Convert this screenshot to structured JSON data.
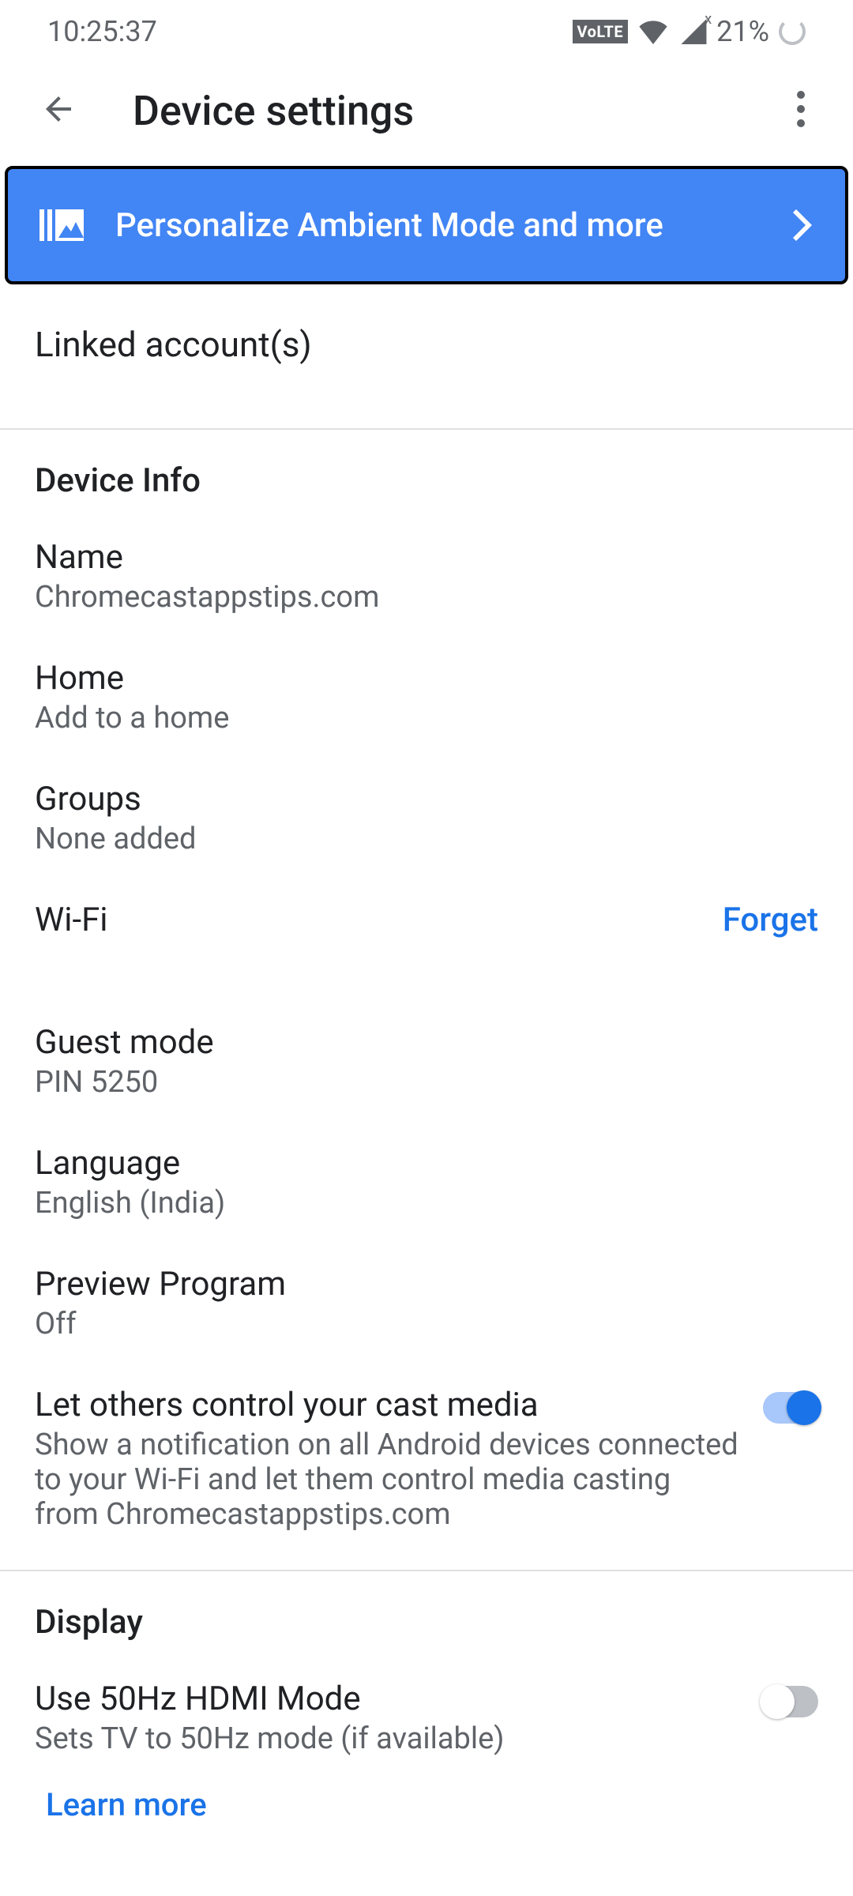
{
  "statusbar": {
    "time": "10:25:37",
    "volte": "VoLTE",
    "battery": "21%"
  },
  "appbar": {
    "title": "Device settings"
  },
  "banner": {
    "text": "Personalize Ambient Mode and more"
  },
  "linked_accounts": {
    "label": "Linked account(s)"
  },
  "sections": {
    "device_info_header": "Device Info",
    "name": {
      "title": "Name",
      "sub": "Chromecastappstips.com"
    },
    "home": {
      "title": "Home",
      "sub": "Add to a home"
    },
    "groups": {
      "title": "Groups",
      "sub": "None added"
    },
    "wifi": {
      "title": "Wi-Fi",
      "action": "Forget"
    },
    "guest_mode": {
      "title": "Guest mode",
      "sub": "PIN 5250"
    },
    "language": {
      "title": "Language",
      "sub": "English (India)"
    },
    "preview": {
      "title": "Preview Program",
      "sub": "Off"
    },
    "cast_control": {
      "title": "Let others control your cast media",
      "sub": "Show a notification on all Android devices connected to your Wi-Fi and let them control media casting from Chromecastappstips.com"
    },
    "display_header": "Display",
    "hdmi": {
      "title": "Use 50Hz HDMI Mode",
      "sub": "Sets TV to 50Hz mode (if available)",
      "learn_more": "Learn more"
    }
  }
}
